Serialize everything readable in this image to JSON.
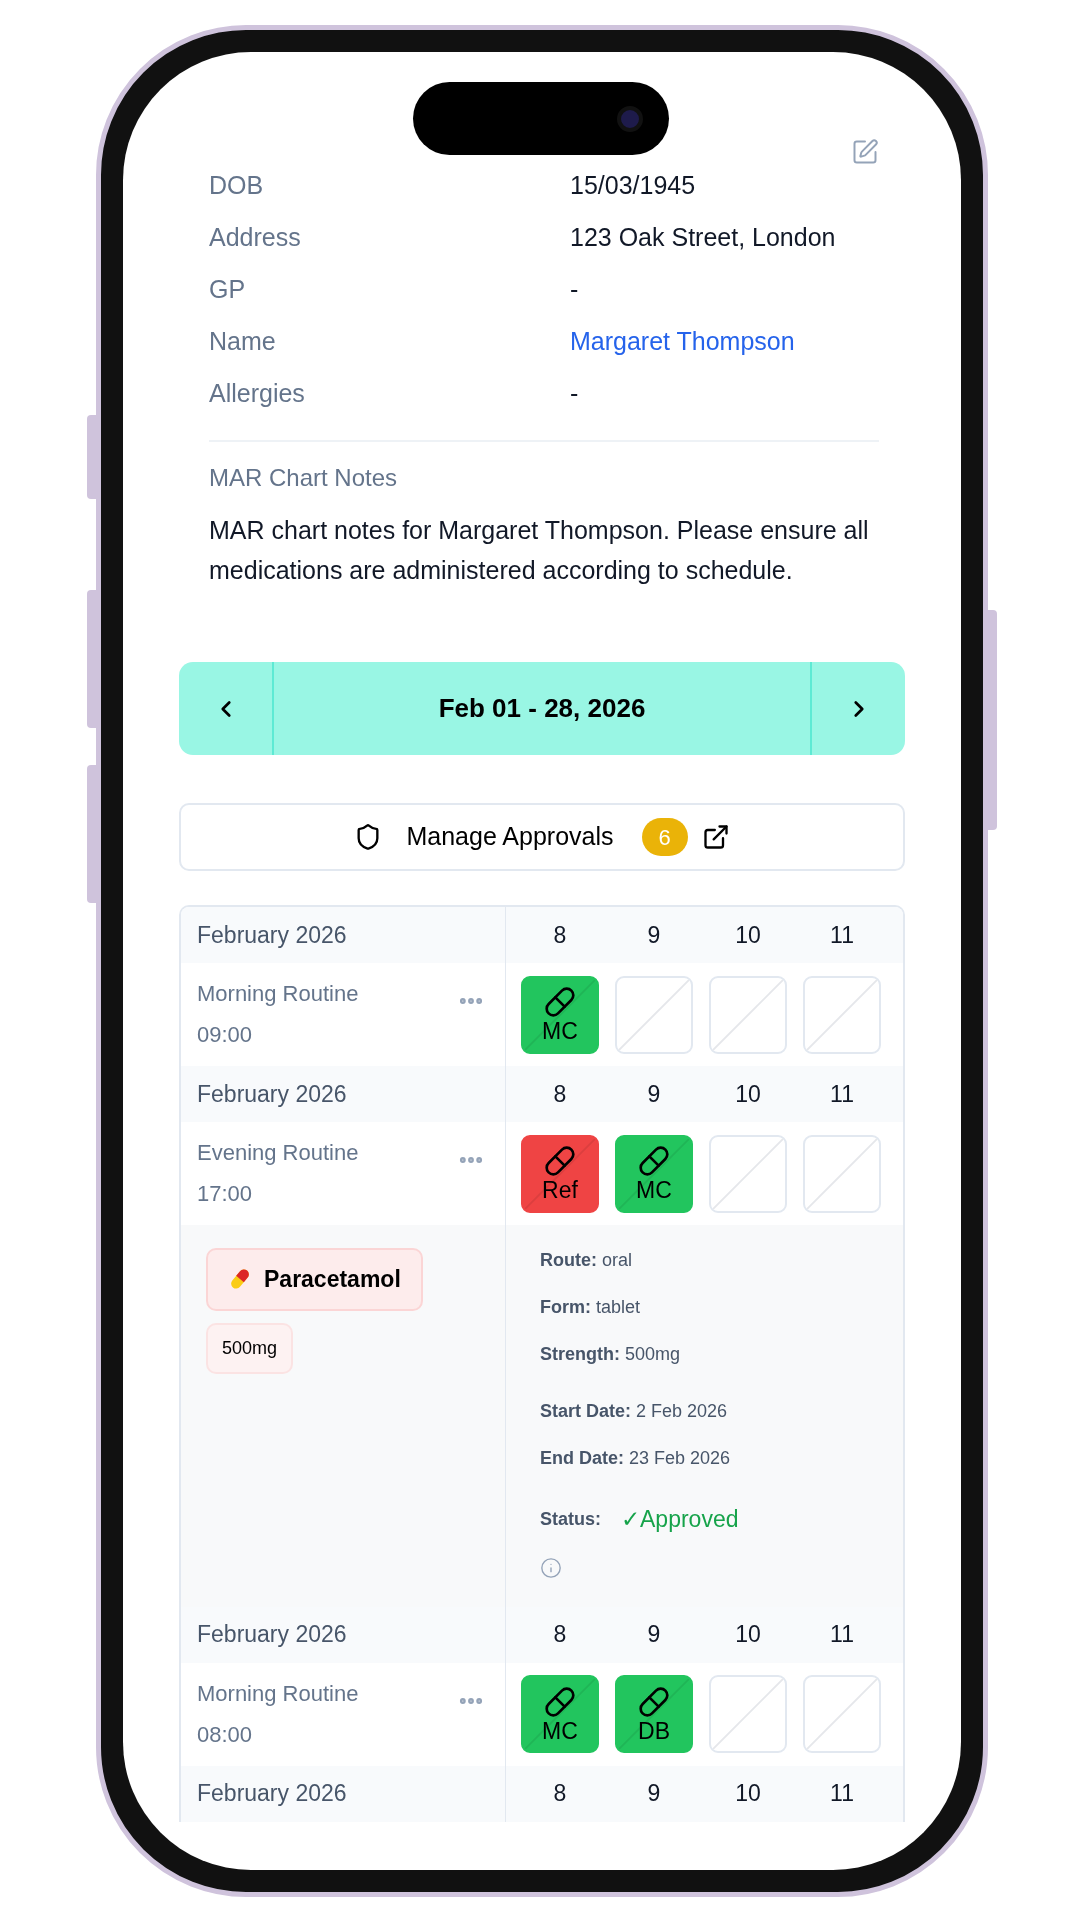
{
  "patient_details": [
    {
      "label": "DOB",
      "value": "15/03/1945",
      "kind": "text"
    },
    {
      "label": "Address",
      "value": "123 Oak Street, London",
      "kind": "text"
    },
    {
      "label": "GP",
      "value": "-",
      "kind": "text"
    },
    {
      "label": "Name",
      "value": "Margaret Thompson",
      "kind": "link"
    },
    {
      "label": "Allergies",
      "value": "-",
      "kind": "text"
    }
  ],
  "notes": {
    "title": "MAR Chart Notes",
    "text": "MAR chart notes for Margaret Thompson. Please ensure all medications are administered according to schedule."
  },
  "date_range": {
    "label": "Feb 01 - 28, 2026"
  },
  "approvals": {
    "label": "Manage Approvals",
    "count": "6"
  },
  "table": {
    "sections": [
      {
        "kind": "routine",
        "month": "February 2026",
        "days": [
          "8",
          "9",
          "10",
          "11"
        ],
        "routine": "Morning Routine",
        "time": "09:00",
        "cells": [
          {
            "kind": "given",
            "code": "MC"
          },
          {
            "kind": "empty"
          },
          {
            "kind": "empty"
          },
          {
            "kind": "empty"
          }
        ]
      },
      {
        "kind": "routine",
        "month": "February 2026",
        "days": [
          "8",
          "9",
          "10",
          "11"
        ],
        "routine": "Evening Routine",
        "time": "17:00",
        "cells": [
          {
            "kind": "refused",
            "code": "Ref"
          },
          {
            "kind": "given",
            "code": "MC"
          },
          {
            "kind": "empty"
          },
          {
            "kind": "empty"
          }
        ]
      },
      {
        "kind": "medication",
        "name": "Paracetamol",
        "dose": "500mg",
        "field_groups": [
          [
            "**Route:** oral",
            "**Form:** tablet",
            "**Strength:** 500mg"
          ],
          [
            "**Start Date:** 2 Feb 2026",
            "**End Date:** 23 Feb 2026"
          ]
        ],
        "status_label": "Status:",
        "status": "✓Approved"
      },
      {
        "kind": "routine",
        "month": "February 2026",
        "days": [
          "8",
          "9",
          "10",
          "11"
        ],
        "routine": "Morning Routine",
        "time": "08:00",
        "cells": [
          {
            "kind": "given",
            "code": "MC"
          },
          {
            "kind": "given",
            "code": "DB"
          },
          {
            "kind": "empty"
          },
          {
            "kind": "empty"
          }
        ]
      },
      {
        "kind": "header",
        "month": "February 2026",
        "days": [
          "8",
          "9",
          "10",
          "11"
        ]
      }
    ]
  }
}
